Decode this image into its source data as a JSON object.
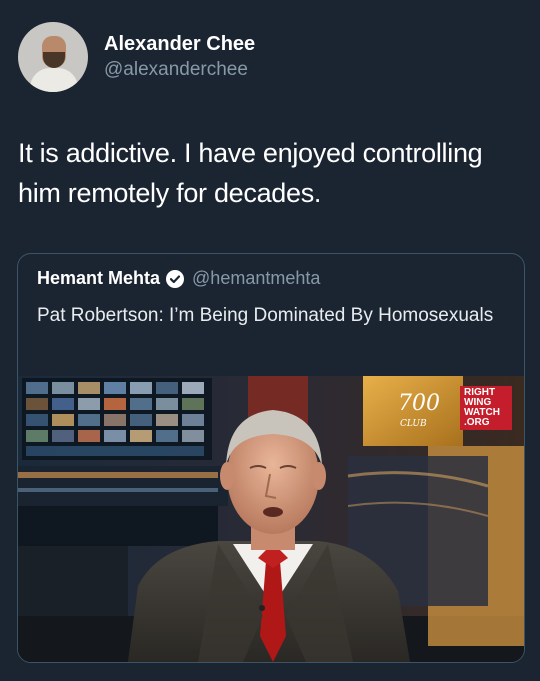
{
  "author": {
    "display_name": "Alexander Chee",
    "handle": "@alexanderchee"
  },
  "tweet": {
    "text": "It is addictive. I have enjoyed controlling him remotely for decades."
  },
  "quoted": {
    "display_name": "Hemant Mehta",
    "handle": "@hemantmehta",
    "text": "Pat Robertson: I’m Being Dominated By Homosexuals",
    "media": {
      "logo_lines": [
        "RIGHT",
        "WING",
        "WATCH",
        ".ORG"
      ],
      "show_label": "700"
    }
  },
  "colors": {
    "background": "#1b2532",
    "secondary_text": "#8899a6",
    "quote_border": "#3d5466",
    "logo_red": "#c41e2d"
  }
}
